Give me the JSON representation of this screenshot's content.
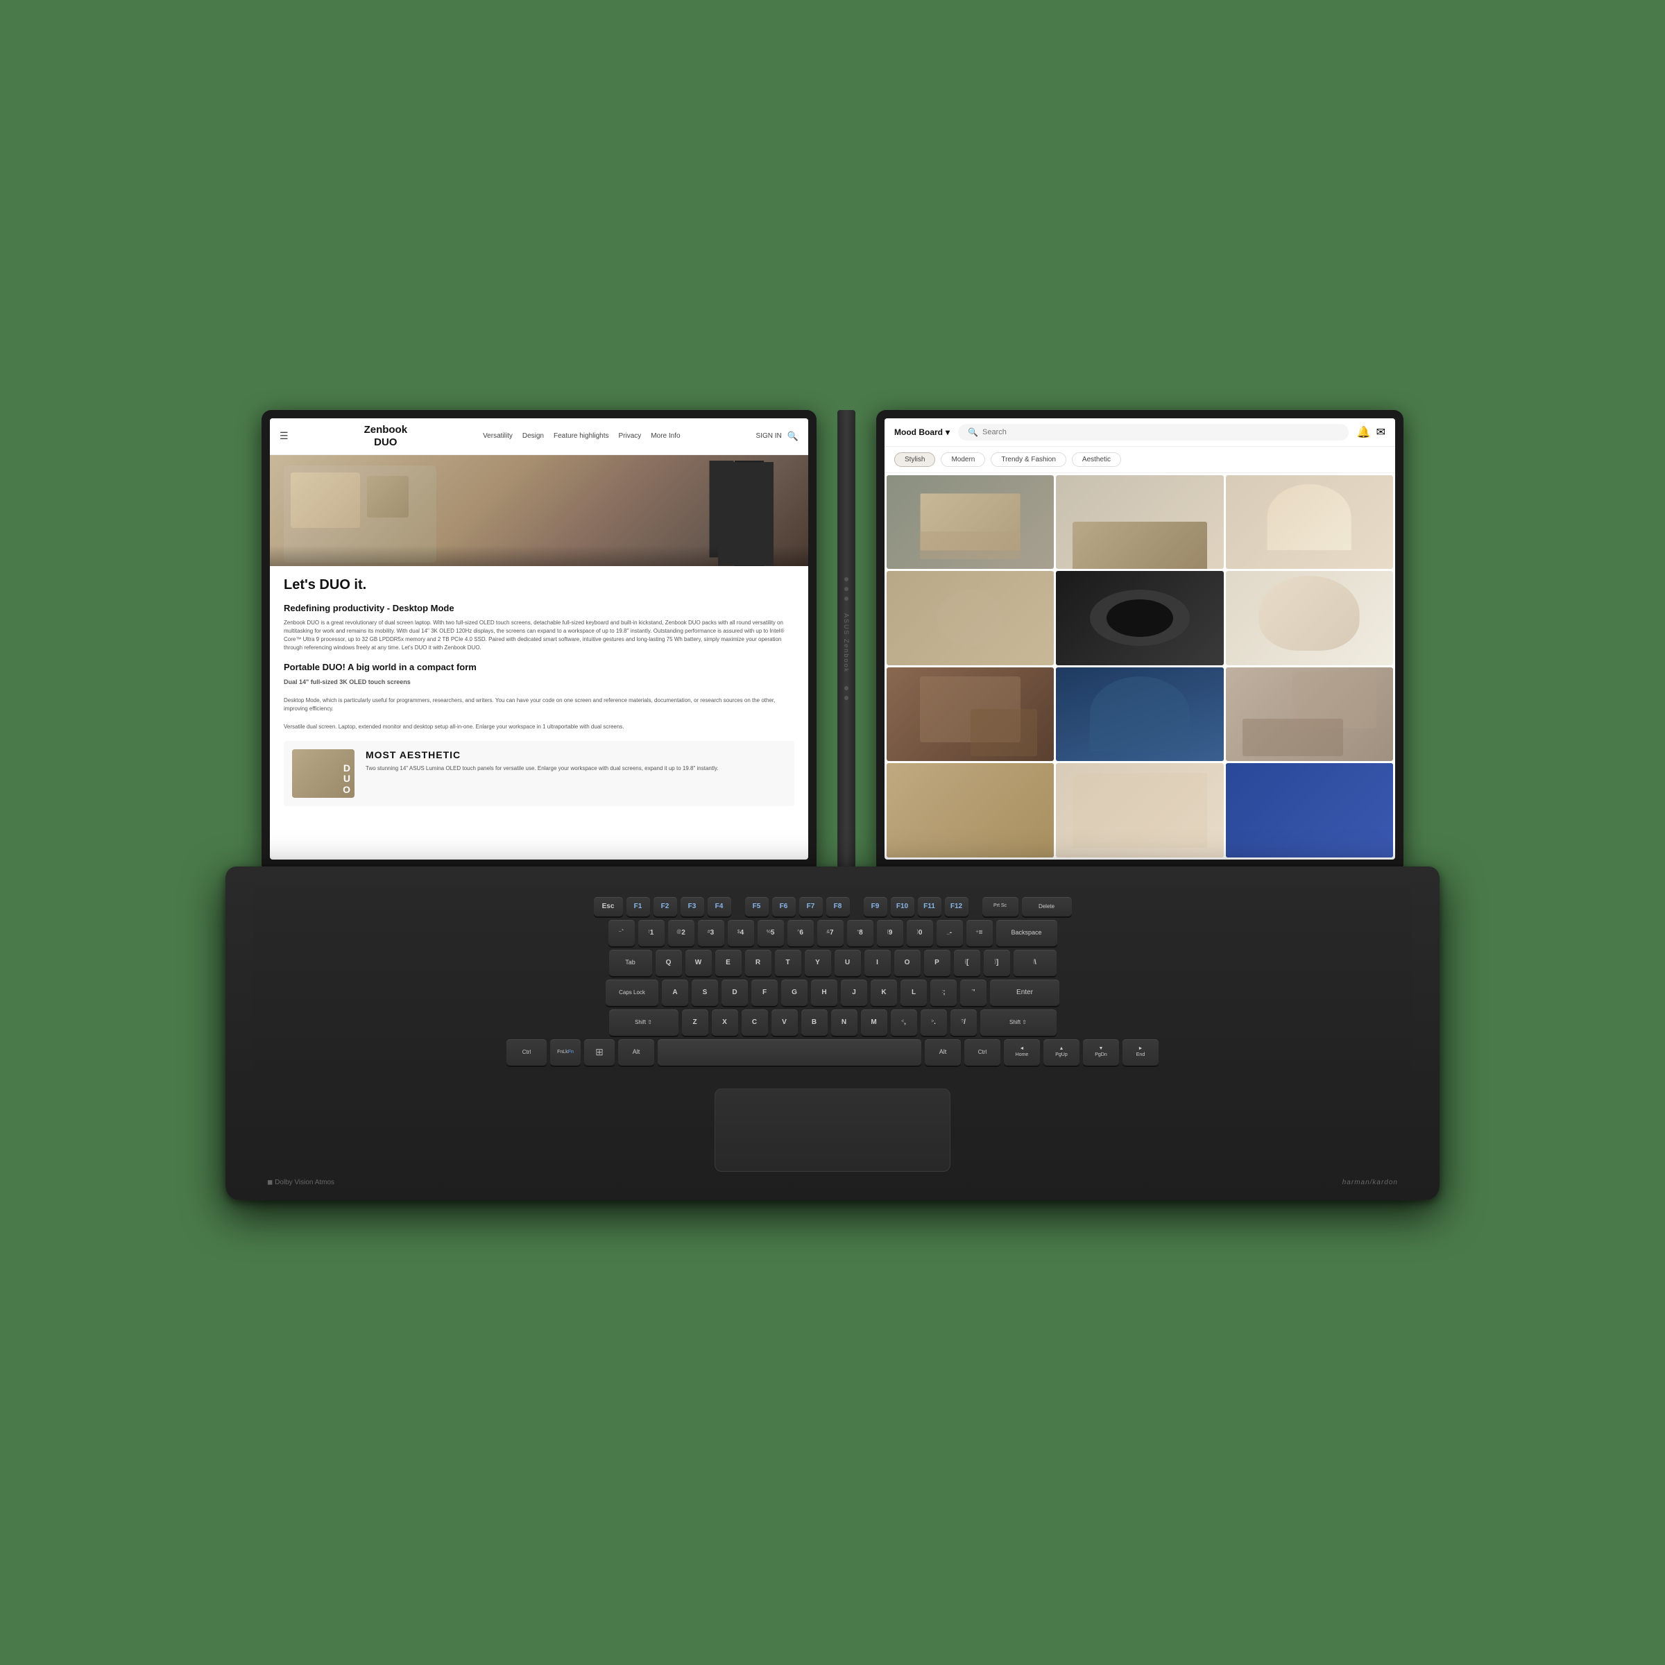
{
  "laptop": {
    "brand": "ASUS Zenbook",
    "model_line1": "Zenbook",
    "model_line2": "DUO"
  },
  "left_screen": {
    "nav": {
      "logo_line1": "Zenbook",
      "logo_line2": "DUO",
      "sign_in": "SIGN IN",
      "links": [
        "Versatility",
        "Design",
        "Feature highlights",
        "Privacy",
        "More Info"
      ]
    },
    "hero_text": "Let's DUO it.",
    "section1_title": "Redefining productivity - Desktop Mode",
    "section1_body": "Zenbook DUO is a great revolutionary of dual screen laptop. With two full-sized OLED touch screens, detachable full-sized keyboard and built-in kickstand, Zenbook DUO packs with all round versatility on multitasking for work and remains its mobility. With dual 14\" 3K OLED 120Hz displays, the screens can expand to a workspace of up to 19.8\" instantly. Outstanding performance is assured with up to Intel® Core™ Ultra 9 processor, up to 32 GB LPDDR5x memory and 2 TB PCIe 4.0 SSD. Paired with dedicated smart software, intuitive gestures and long-lasting 75 Wh battery, simply maximize your operation through referencing windows freely at any time. Let's DUO it with Zenbook DUO.",
    "section2_title": "Portable DUO! A big world in a compact form",
    "section2_subtitle": "Dual 14\" full-sized 3K OLED touch screens",
    "section2_body1": "Desktop Mode, which is particularly useful for programmers, researchers, and writers. You can have your code on one screen and reference materials, documentation, or research sources on the other, improving efficiency.",
    "section2_body2": "Versatile dual screen. Laptop, extended monitor and desktop setup all-in-one. Enlarge your workspace in 1 ultraportable with dual screens.",
    "duo_badge": "D\nU\nO",
    "aesthetic_title": "MOST AESTHETIC",
    "aesthetic_body": "Two stunning 14\" ASUS Lumina OLED touch panels for versatile use. Enlarge your workspace with dual screens, expand it up to 19.8\" instantly."
  },
  "right_screen": {
    "header": {
      "mood_board_label": "Mood Board",
      "search_placeholder": "Search",
      "chevron": "▾"
    },
    "tags": [
      "Stylish",
      "Modern",
      "Trendy & Fashion",
      "Aesthetic"
    ],
    "active_tag": "Stylish"
  },
  "keyboard": {
    "dolby": "◼ Dolby Vision Atmos",
    "harman": "harman/kardon",
    "rows": {
      "fn_row": [
        "Esc",
        "F1",
        "F2",
        "F3",
        "F4",
        "F5",
        "F6",
        "F7",
        "F8",
        "F9",
        "F10",
        "F11",
        "F12",
        "Prt Sc",
        "Delete"
      ],
      "num_row": [
        "`~",
        "1!",
        "2@",
        "3#",
        "4$",
        "5%",
        "6^",
        "7&",
        "8*",
        "9(",
        "0)",
        "-_",
        "=+",
        "Backspace"
      ],
      "qwerty": [
        "Tab",
        "Q",
        "W",
        "E",
        "R",
        "T",
        "Y",
        "U",
        "I",
        "O",
        "P",
        "[{",
        "]}",
        "\\|"
      ],
      "home_row": [
        "Caps Lock",
        "A",
        "S",
        "D",
        "F",
        "G",
        "H",
        "J",
        "K",
        "L",
        ";:",
        "'\"",
        "Enter"
      ],
      "shift_row": [
        "Shift",
        "Z",
        "X",
        "C",
        "V",
        "B",
        "N",
        "M",
        ",<",
        ".>",
        "/?",
        "Shift"
      ],
      "bottom_row": [
        "Ctrl",
        "FnLk\nFn",
        "⊞",
        "Alt",
        "",
        "Alt",
        "Ctrl",
        "◄Home",
        "▲PgUp",
        "▼PgDn",
        "►End"
      ]
    }
  }
}
